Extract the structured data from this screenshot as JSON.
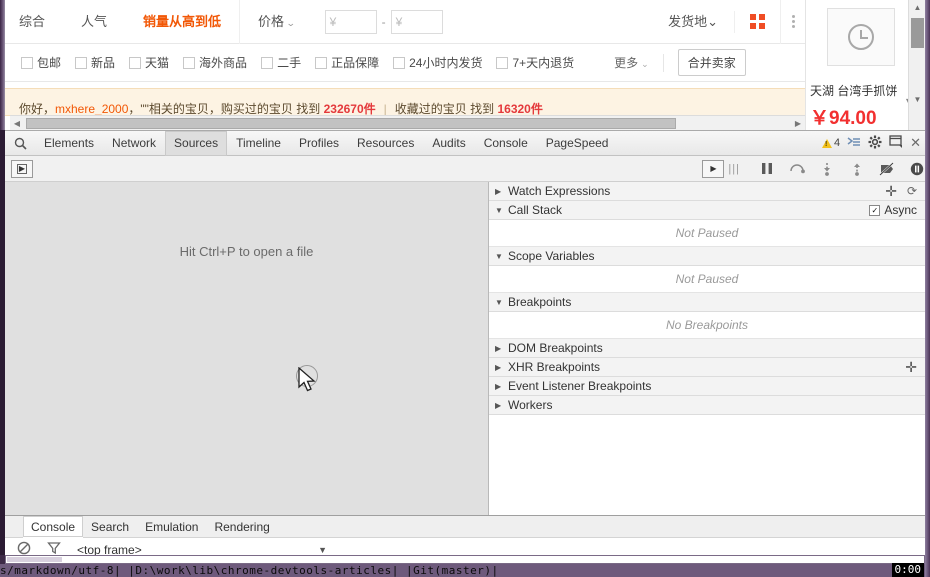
{
  "shopping": {
    "sort_options": [
      {
        "label": "综合",
        "active": false
      },
      {
        "label": "人气",
        "active": false
      },
      {
        "label": "销量从高到低",
        "active": true
      }
    ],
    "price_sort_label": "价格",
    "price_min_placeholder": "¥",
    "price_max_placeholder": "¥",
    "price_min_value": "",
    "price_max_value": "",
    "price_dash": "-",
    "ship_from_label": "发货地",
    "caret": "⌄",
    "filters": [
      {
        "label": "包邮",
        "checked": false
      },
      {
        "label": "新品",
        "checked": false
      },
      {
        "label": "天猫",
        "checked": false
      },
      {
        "label": "海外商品",
        "checked": false
      },
      {
        "label": "二手",
        "checked": false
      },
      {
        "label": "正品保障",
        "checked": false
      },
      {
        "label": "24小时内发货",
        "checked": false
      },
      {
        "label": "7+天内退货",
        "checked": false
      }
    ],
    "more_label": "更多",
    "merge_sellers_label": "合并卖家",
    "banner": {
      "greeting": "你好，",
      "user": "mxhere_2000",
      "middle": "，\"\"相关的宝贝，购买过的宝贝 找到",
      "count1": "232670件",
      "separator": "|",
      "middle2": "收藏过的宝贝 找到",
      "count2": "16320件"
    },
    "product": {
      "title": "天湖 台湾手抓饼",
      "price": "￥94.00",
      "image_icon": "clock-placeholder-icon"
    },
    "accent_color": "#f25807",
    "price_color": "#f23030"
  },
  "devtools": {
    "tabs": [
      {
        "label": "Elements",
        "active": false
      },
      {
        "label": "Network",
        "active": false
      },
      {
        "label": "Sources",
        "active": true
      },
      {
        "label": "Timeline",
        "active": false
      },
      {
        "label": "Profiles",
        "active": false
      },
      {
        "label": "Resources",
        "active": false
      },
      {
        "label": "Audits",
        "active": false
      },
      {
        "label": "Console",
        "active": false
      },
      {
        "label": "PageSpeed",
        "active": false
      }
    ],
    "warning_count": "4",
    "toolbar_icons": {
      "search": "search-icon",
      "warning": "warning-icon",
      "console_drawer": "console-drawer-icon",
      "settings": "gear-icon",
      "dock": "dock-icon",
      "close": "close-icon"
    },
    "debug_controls": [
      {
        "name": "pause-resume-button",
        "glyph": "❚❚"
      },
      {
        "name": "step-over-button",
        "glyph": "⤻"
      },
      {
        "name": "step-into-button",
        "glyph": "⤓"
      },
      {
        "name": "step-out-button",
        "glyph": "⤒"
      },
      {
        "name": "deactivate-breakpoints-button",
        "glyph": "⊘"
      },
      {
        "name": "pause-on-exceptions-button",
        "glyph": "⏸"
      }
    ],
    "source_hint": "Hit Ctrl+P to open a file",
    "sidebar_sections": [
      {
        "title": "Watch Expressions",
        "expanded": false,
        "body": null,
        "has_add": true,
        "has_refresh": true
      },
      {
        "title": "Call Stack",
        "expanded": true,
        "body": "Not Paused",
        "async_label": "Async",
        "async_checked": true
      },
      {
        "title": "Scope Variables",
        "expanded": true,
        "body": "Not Paused"
      },
      {
        "title": "Breakpoints",
        "expanded": true,
        "body": "No Breakpoints"
      },
      {
        "title": "DOM Breakpoints",
        "expanded": false,
        "body": null
      },
      {
        "title": "XHR Breakpoints",
        "expanded": false,
        "body": null,
        "has_add": true
      },
      {
        "title": "Event Listener Breakpoints",
        "expanded": false,
        "body": null
      },
      {
        "title": "Workers",
        "expanded": false,
        "body": null
      }
    ],
    "drawer_tabs": [
      {
        "label": "Console",
        "active": true
      },
      {
        "label": "Search",
        "active": false
      },
      {
        "label": "Emulation",
        "active": false
      },
      {
        "label": "Rendering",
        "active": false
      }
    ],
    "console": {
      "clear_icon": "clear-console-icon",
      "filter_icon": "filter-icon",
      "frame_selector_value": "<top frame>",
      "input_value": ""
    }
  },
  "statusbar": {
    "text": "s/markdown/utf-8|  |D:\\work\\lib\\chrome-devtools-articles|  |Git(master)|",
    "clock": "0:00"
  }
}
